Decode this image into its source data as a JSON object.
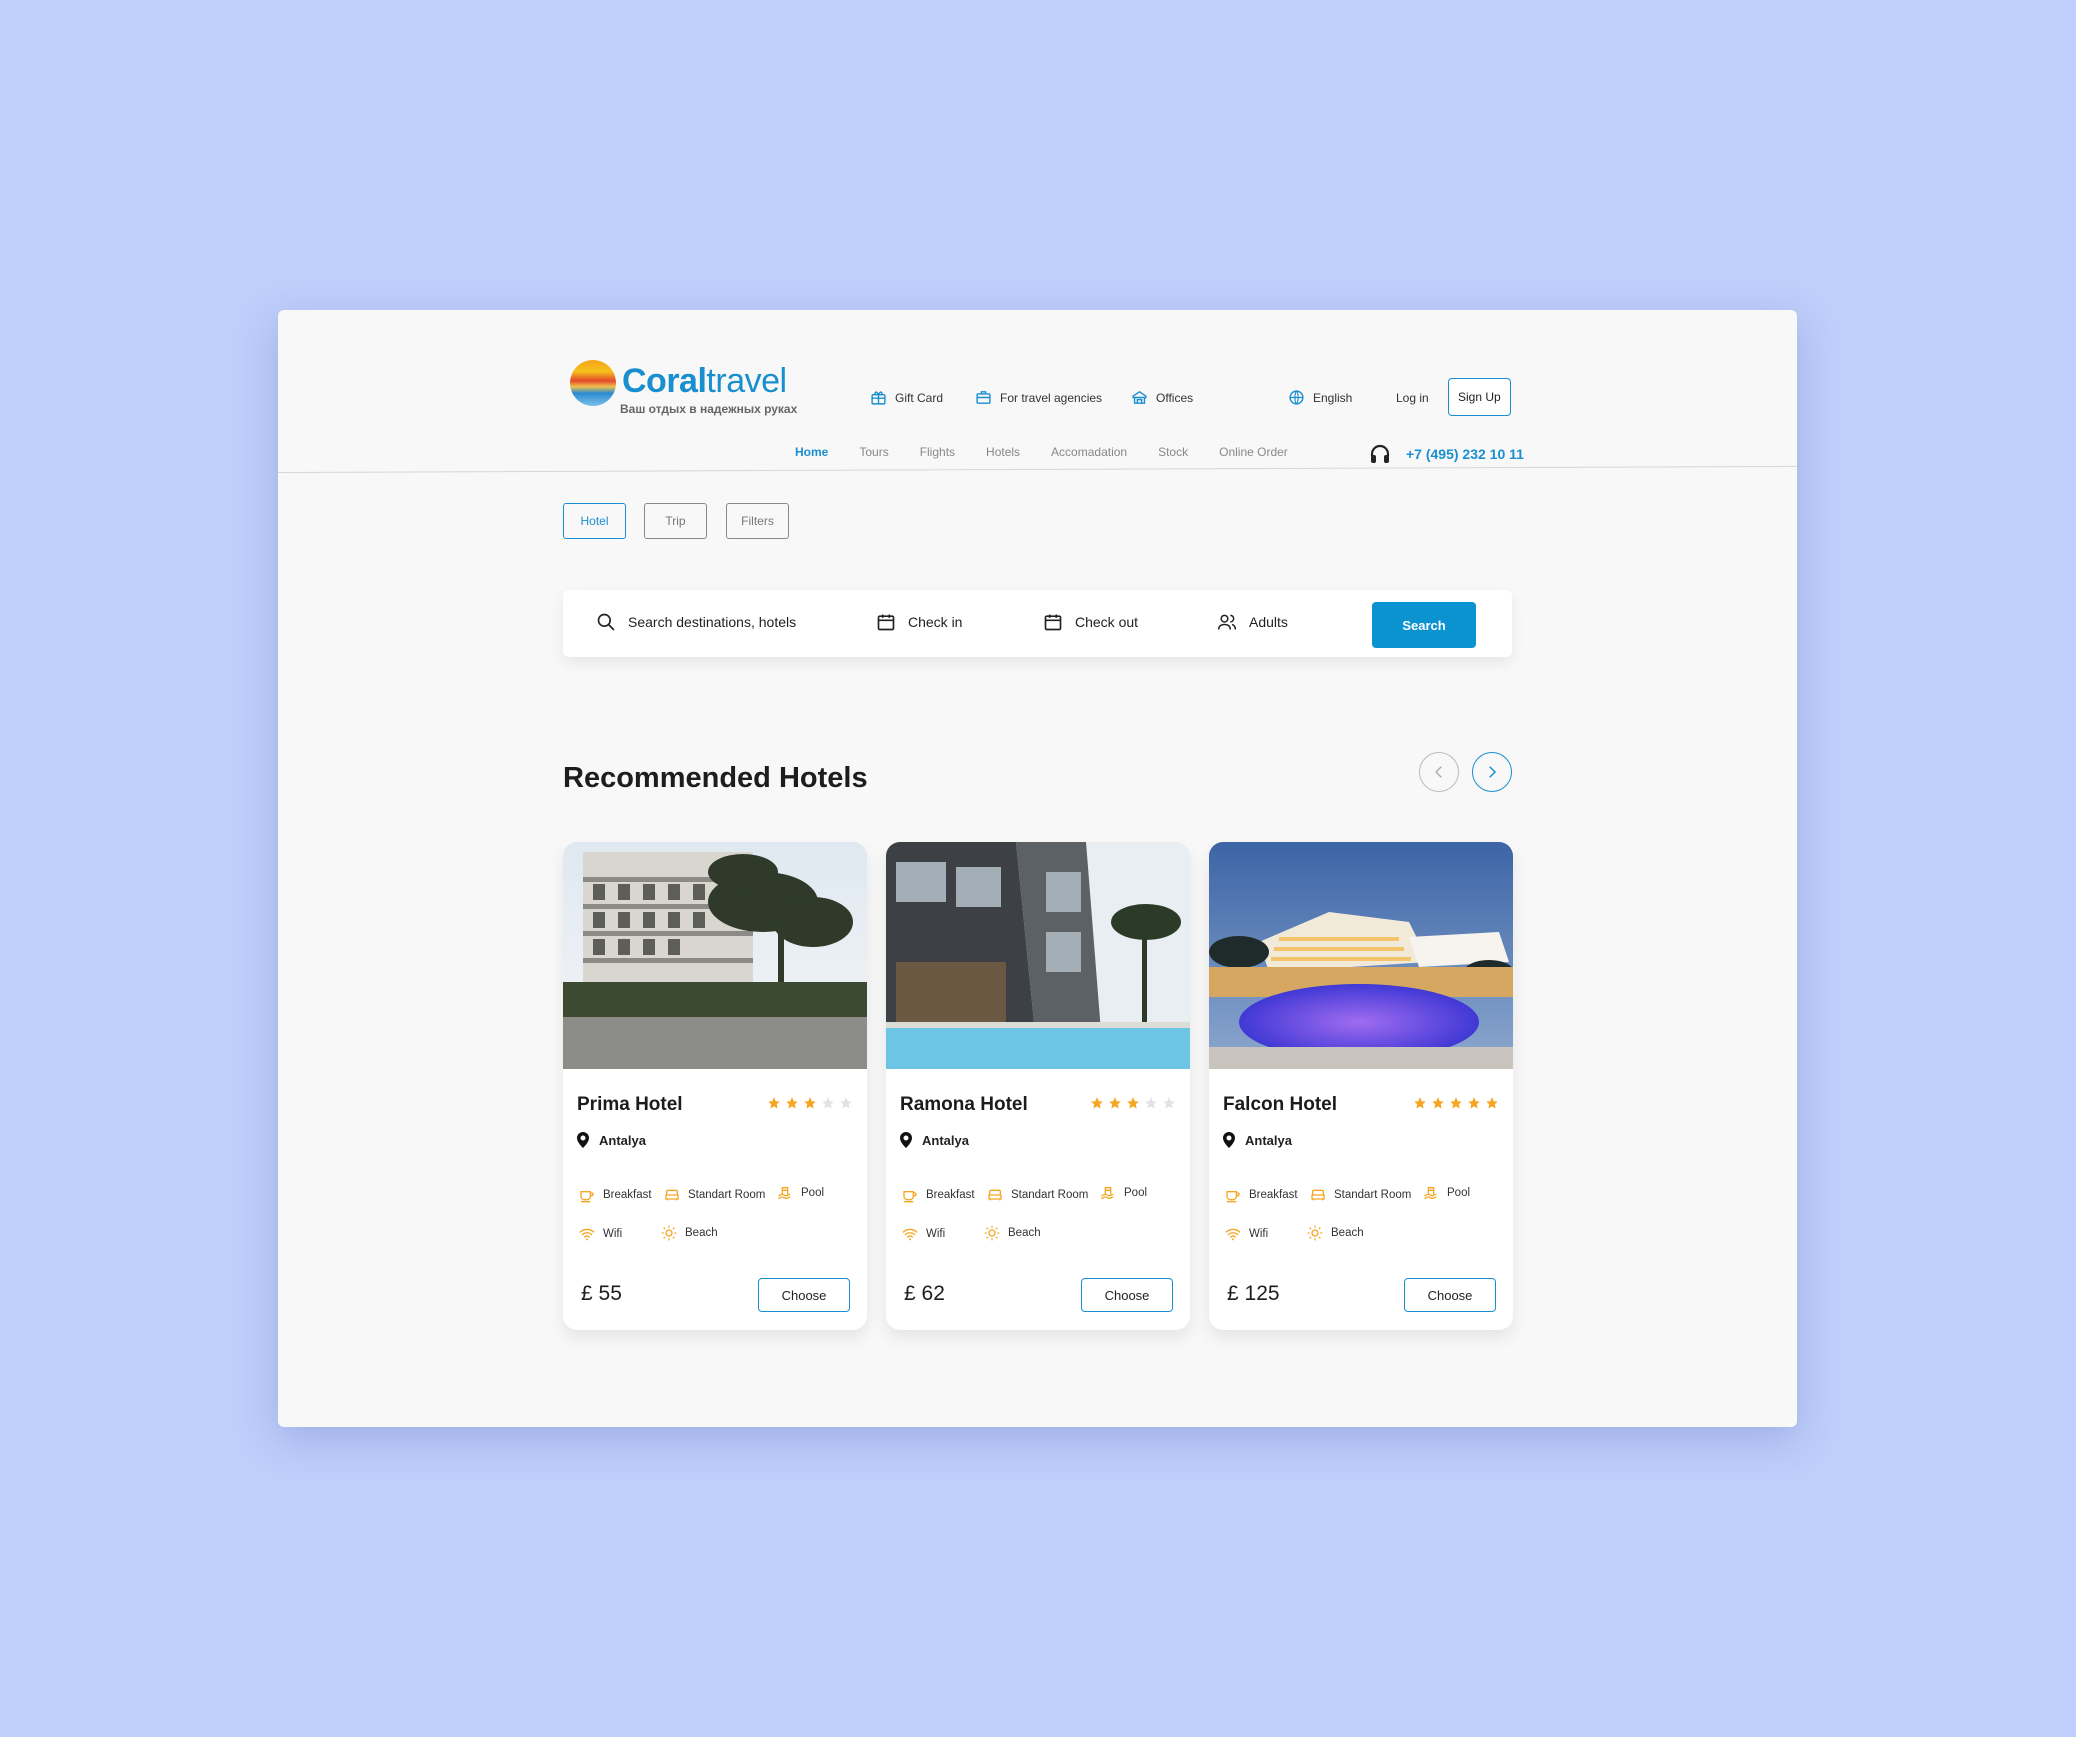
{
  "brand": {
    "name_bold": "Coral",
    "name_light": "travel",
    "tagline": "Ваш отдых в надежных руках"
  },
  "header": {
    "links": [
      {
        "label": "Gift Card",
        "icon": "gift-icon"
      },
      {
        "label": "For travel agencies",
        "icon": "briefcase-icon"
      },
      {
        "label": "Offices",
        "icon": "office-icon"
      }
    ],
    "language": "English",
    "login": "Log in",
    "signup": "Sign Up",
    "phone": "+7 (495) 232 10 11"
  },
  "nav": {
    "items": [
      "Home",
      "Tours",
      "Flights",
      "Hotels",
      "Accomadation",
      "Stock",
      "Online Order"
    ],
    "active": "Home"
  },
  "filter_tabs": [
    "Hotel",
    "Trip",
    "Filters"
  ],
  "search": {
    "destination_placeholder": "Search destinations, hotels",
    "check_in": "Check in",
    "check_out": "Check out",
    "adults": "Adults",
    "button": "Search"
  },
  "section": {
    "title": "Recommended Hotels"
  },
  "hotels": [
    {
      "name": "Prima Hotel",
      "stars": 3,
      "location": "Antalya",
      "price": "£ 55",
      "amenities": [
        "Breakfast",
        "Standart Room",
        "Pool",
        "Wifi",
        "Beach"
      ],
      "button": "Choose"
    },
    {
      "name": "Ramona Hotel",
      "stars": 3,
      "location": "Antalya",
      "price": "£ 62",
      "amenities": [
        "Breakfast",
        "Standart Room",
        "Pool",
        "Wifi",
        "Beach"
      ],
      "button": "Choose"
    },
    {
      "name": "Falcon Hotel",
      "stars": 5,
      "location": "Antalya",
      "price": "£ 125",
      "amenities": [
        "Breakfast",
        "Standart Room",
        "Pool",
        "Wifi",
        "Beach"
      ],
      "button": "Choose"
    }
  ],
  "colors": {
    "accent": "#1a8fd0",
    "button": "#0b93d1",
    "star": "#f5a623",
    "background": "#bfcefb"
  }
}
